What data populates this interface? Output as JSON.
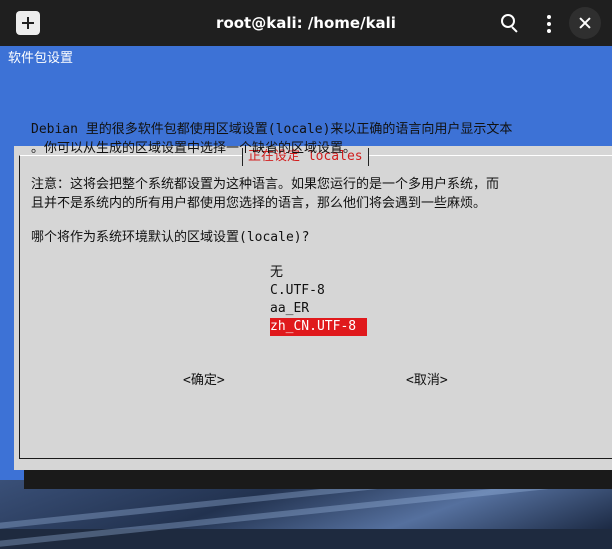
{
  "window": {
    "title": "root@kali: /home/kali"
  },
  "terminal": {
    "backtitle": "软件包设置",
    "dialog": {
      "title": "正在设定 locales",
      "description": [
        "Debian 里的很多软件包都使用区域设置(locale)来以正确的语言向用户显示文本",
        "。你可以从生成的区域设置中选择一个缺省的区域设置。",
        "",
        "注意：这将会把整个系统都设置为这种语言。如果您运行的是一个多用户系统，而",
        "且并不是系统内的所有用户都使用您选择的语言，那么他们将会遇到一些麻烦。",
        "",
        "哪个将作为系统环境默认的区域设置(locale)?"
      ],
      "options": [
        "无",
        "C.UTF-8",
        "aa_ER",
        "zh_CN.UTF-8"
      ],
      "selected_option": "zh_CN.UTF-8",
      "ok_label": "<确定>",
      "cancel_label": "<取消>"
    }
  },
  "colors": {
    "terminal_background": "#3d72d6",
    "dialog_background": "#d6d6d6",
    "selection": "#e0191c",
    "title_text": "#d21e1e",
    "titlebar": "#1f1f1f"
  }
}
